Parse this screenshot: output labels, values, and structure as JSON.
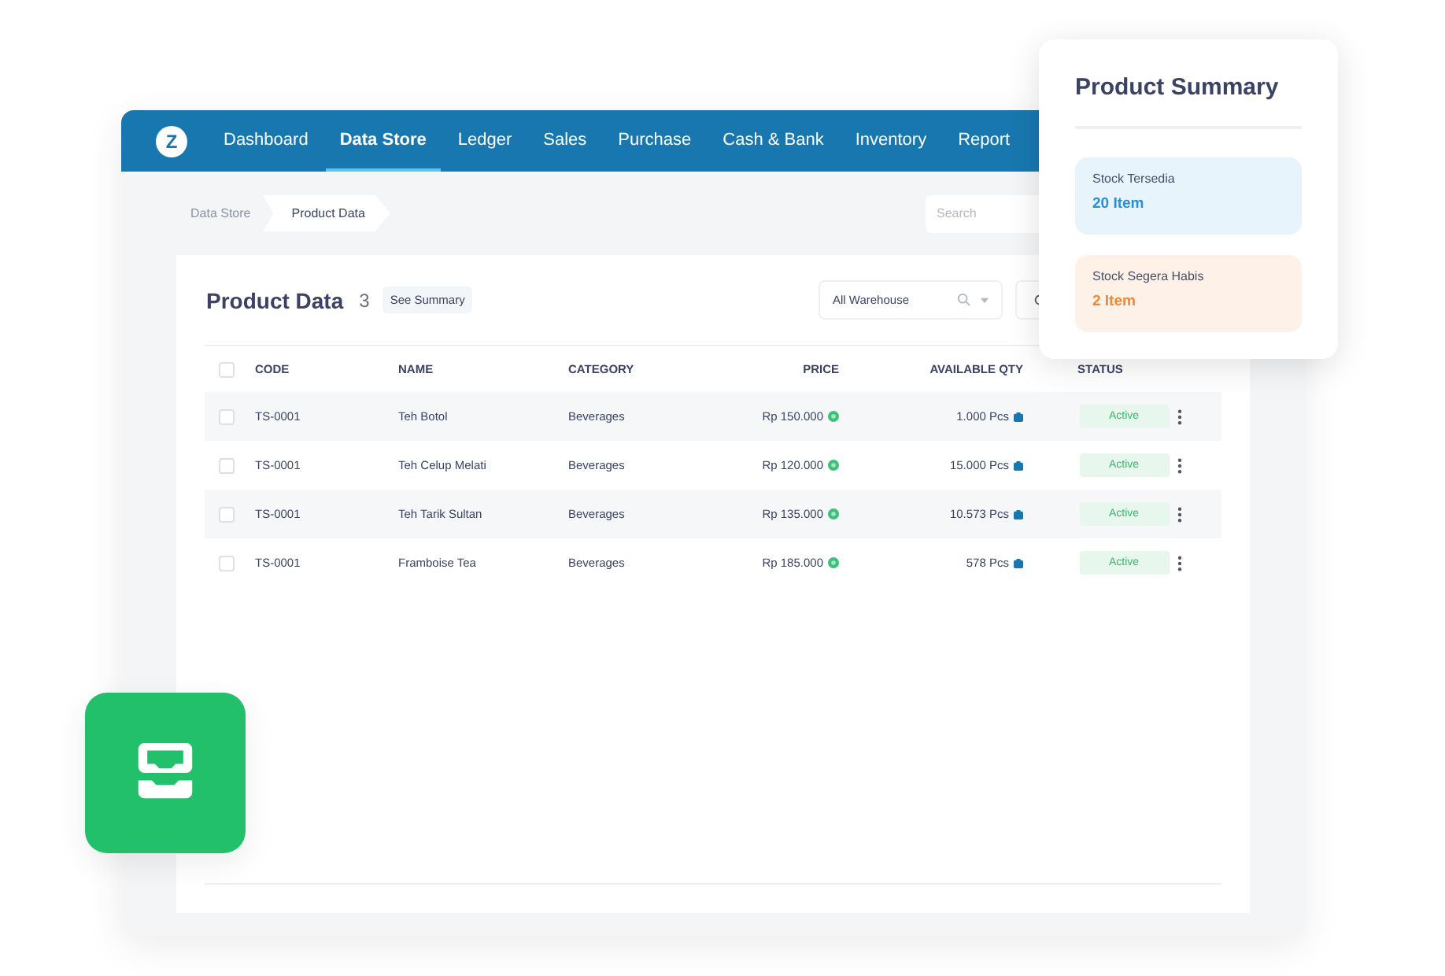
{
  "app": {
    "logo": "Z",
    "nav": [
      {
        "label": "Dashboard",
        "selected": false
      },
      {
        "label": "Data Store",
        "selected": true
      },
      {
        "label": "Ledger",
        "selected": false
      },
      {
        "label": "Sales",
        "selected": false
      },
      {
        "label": "Purchase",
        "selected": false
      },
      {
        "label": "Cash & Bank",
        "selected": false
      },
      {
        "label": "Inventory",
        "selected": false
      },
      {
        "label": "Report",
        "selected": false
      }
    ],
    "breadcrumb": [
      "Data Store",
      "Product Data"
    ],
    "search": {
      "placeholder": "Search"
    }
  },
  "panel": {
    "title": "Product Data",
    "count": "3",
    "summary_button": "See Summary",
    "warehouse_filter": "All Warehouse",
    "table": {
      "select_all_checked": false,
      "columns": [
        "CODE",
        "NAME",
        "CATEGORY",
        "PRICE",
        "AVAILABLE QTY",
        "STATUS"
      ],
      "rows": [
        {
          "checked": false,
          "code": "TS-0001",
          "name": "Teh Botol",
          "category": "Beverages",
          "price": "Rp 150.000",
          "qty": "1.000 Pcs",
          "status": "Active"
        },
        {
          "checked": false,
          "code": "TS-0001",
          "name": "Teh Celup Melati",
          "category": "Beverages",
          "price": "Rp 120.000",
          "qty": "15.000 Pcs",
          "status": "Active"
        },
        {
          "checked": false,
          "code": "TS-0001",
          "name": "Teh Tarik Sultan",
          "category": "Beverages",
          "price": "Rp 135.000",
          "qty": "10.573 Pcs",
          "status": "Active"
        },
        {
          "checked": false,
          "code": "TS-0001",
          "name": "Framboise Tea",
          "category": "Beverages",
          "price": "Rp 185.000",
          "qty": "578 Pcs",
          "status": "Active"
        }
      ]
    }
  },
  "summary": {
    "title": "Product Summary",
    "stats": [
      {
        "kind": "info",
        "label": "Stock Tersedia",
        "value": "20 Item"
      },
      {
        "kind": "warning",
        "label": "Stock Segera Habis",
        "value": "2 Item"
      }
    ]
  }
}
